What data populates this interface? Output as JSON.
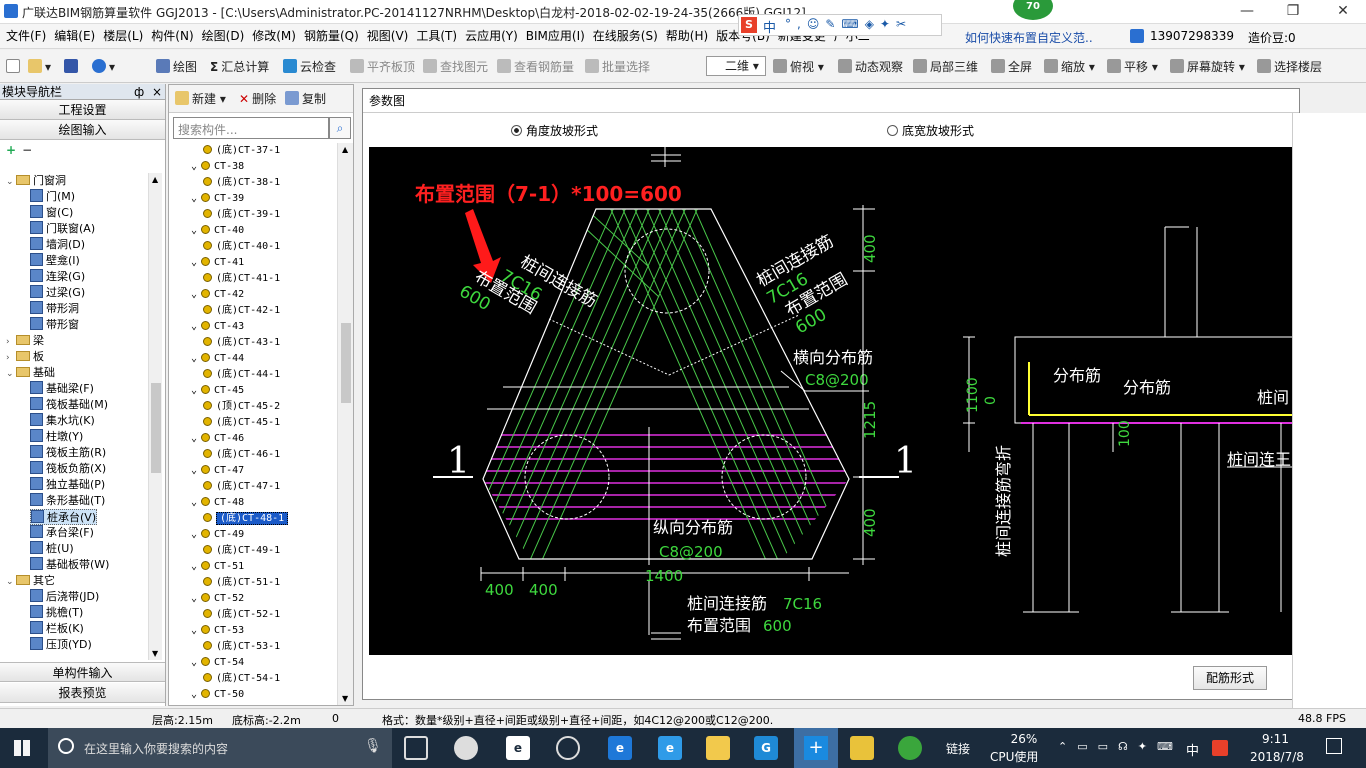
{
  "window": {
    "title": "广联达BIM钢筋算量软件 GGJ2013 - [C:\\Users\\Administrator.PC-20141127NRHM\\Desktop\\白龙村-2018-02-02-19-24-35(2666版).GGJ12]",
    "badge": "70",
    "ime": "中"
  },
  "menu": [
    "文件(F)",
    "编辑(E)",
    "楼层(L)",
    "构件(N)",
    "绘图(D)",
    "修改(M)",
    "钢筋量(Q)",
    "视图(V)",
    "工具(T)",
    "云应用(Y)",
    "BIM应用(I)",
    "在线服务(S)",
    "帮助(H)",
    "版本号(B)",
    "新建变更",
    "广小二"
  ],
  "menu_right": {
    "help_link": "如何快速布置自定义范..",
    "phone": "13907298339",
    "price": "造价豆:0"
  },
  "toolbar": {
    "draw": "绘图",
    "sum": "汇总计算",
    "cloud_check": "云检查",
    "flat_top": "平齐板顶",
    "find": "查找图元",
    "view_rebar": "查看钢筋量",
    "batch": "批量选择",
    "view_mode": "二维",
    "top_view": "俯视",
    "dynamic": "动态观察",
    "local3d": "局部三维",
    "fullscreen": "全屏",
    "zoom": "缩放",
    "pan": "平移",
    "rotate": "屏幕旋转",
    "select_floor": "选择楼层"
  },
  "nav": {
    "title": "模块导航栏",
    "pin": "ф",
    "close": "×",
    "proj": "工程设置",
    "draw_input": "绘图输入",
    "single": "单构件输入",
    "report": "报表预览",
    "tree": [
      {
        "level": 0,
        "label": "门窗洞",
        "type": "folder",
        "exp": "⌄"
      },
      {
        "level": 1,
        "label": "门(M)",
        "type": "leaf"
      },
      {
        "level": 1,
        "label": "窗(C)",
        "type": "leaf"
      },
      {
        "level": 1,
        "label": "门联窗(A)",
        "type": "leaf"
      },
      {
        "level": 1,
        "label": "墙洞(D)",
        "type": "leaf"
      },
      {
        "level": 1,
        "label": "壁龛(I)",
        "type": "leaf"
      },
      {
        "level": 1,
        "label": "连梁(G)",
        "type": "leaf"
      },
      {
        "level": 1,
        "label": "过梁(G)",
        "type": "leaf"
      },
      {
        "level": 1,
        "label": "带形洞",
        "type": "leaf"
      },
      {
        "level": 1,
        "label": "带形窗",
        "type": "leaf"
      },
      {
        "level": 0,
        "label": "梁",
        "type": "folder",
        "exp": "›"
      },
      {
        "level": 0,
        "label": "板",
        "type": "folder",
        "exp": "›"
      },
      {
        "level": 0,
        "label": "基础",
        "type": "folder",
        "exp": "⌄"
      },
      {
        "level": 1,
        "label": "基础梁(F)",
        "type": "leaf"
      },
      {
        "level": 1,
        "label": "筏板基础(M)",
        "type": "leaf"
      },
      {
        "level": 1,
        "label": "集水坑(K)",
        "type": "leaf"
      },
      {
        "level": 1,
        "label": "柱墩(Y)",
        "type": "leaf"
      },
      {
        "level": 1,
        "label": "筏板主筋(R)",
        "type": "leaf"
      },
      {
        "level": 1,
        "label": "筏板负筋(X)",
        "type": "leaf"
      },
      {
        "level": 1,
        "label": "独立基础(P)",
        "type": "leaf"
      },
      {
        "level": 1,
        "label": "条形基础(T)",
        "type": "leaf"
      },
      {
        "level": 1,
        "label": "桩承台(V)",
        "type": "leaf",
        "selected": true
      },
      {
        "level": 1,
        "label": "承台梁(F)",
        "type": "leaf"
      },
      {
        "level": 1,
        "label": "桩(U)",
        "type": "leaf"
      },
      {
        "level": 1,
        "label": "基础板带(W)",
        "type": "leaf"
      },
      {
        "level": 0,
        "label": "其它",
        "type": "folder",
        "exp": "⌄"
      },
      {
        "level": 1,
        "label": "后浇带(JD)",
        "type": "leaf"
      },
      {
        "level": 1,
        "label": "挑檐(T)",
        "type": "leaf"
      },
      {
        "level": 1,
        "label": "栏板(K)",
        "type": "leaf"
      },
      {
        "level": 1,
        "label": "压顶(YD)",
        "type": "leaf"
      }
    ]
  },
  "components": {
    "new": "新建",
    "delete": "删除",
    "copy": "复制",
    "search_placeholder": "搜索构件...",
    "items": [
      {
        "level": 1,
        "label": "(底)CT-37-1"
      },
      {
        "level": 0,
        "label": "CT-38"
      },
      {
        "level": 1,
        "label": "(底)CT-38-1"
      },
      {
        "level": 0,
        "label": "CT-39"
      },
      {
        "level": 1,
        "label": "(底)CT-39-1"
      },
      {
        "level": 0,
        "label": "CT-40"
      },
      {
        "level": 1,
        "label": "(底)CT-40-1"
      },
      {
        "level": 0,
        "label": "CT-41"
      },
      {
        "level": 1,
        "label": "(底)CT-41-1"
      },
      {
        "level": 0,
        "label": "CT-42"
      },
      {
        "level": 1,
        "label": "(底)CT-42-1"
      },
      {
        "level": 0,
        "label": "CT-43"
      },
      {
        "level": 1,
        "label": "(底)CT-43-1"
      },
      {
        "level": 0,
        "label": "CT-44"
      },
      {
        "level": 1,
        "label": "(底)CT-44-1"
      },
      {
        "level": 0,
        "label": "CT-45"
      },
      {
        "level": 1,
        "label": "(顶)CT-45-2"
      },
      {
        "level": 1,
        "label": "(底)CT-45-1"
      },
      {
        "level": 0,
        "label": "CT-46"
      },
      {
        "level": 1,
        "label": "(底)CT-46-1"
      },
      {
        "level": 0,
        "label": "CT-47"
      },
      {
        "level": 1,
        "label": "(底)CT-47-1"
      },
      {
        "level": 0,
        "label": "CT-48"
      },
      {
        "level": 1,
        "label": "(底)CT-48-1",
        "selected": true
      },
      {
        "level": 0,
        "label": "CT-49"
      },
      {
        "level": 1,
        "label": "(底)CT-49-1"
      },
      {
        "level": 0,
        "label": "CT-51"
      },
      {
        "level": 1,
        "label": "(底)CT-51-1"
      },
      {
        "level": 0,
        "label": "CT-52"
      },
      {
        "level": 1,
        "label": "(底)CT-52-1"
      },
      {
        "level": 0,
        "label": "CT-53"
      },
      {
        "level": 1,
        "label": "(底)CT-53-1"
      },
      {
        "level": 0,
        "label": "CT-54"
      },
      {
        "level": 1,
        "label": "(底)CT-54-1"
      },
      {
        "level": 0,
        "label": "CT-50"
      }
    ]
  },
  "dialog": {
    "title": "参数图",
    "radio1": "角度放坡形式",
    "radio2": "底宽放坡形式",
    "config_btn": "配筋形式"
  },
  "drawing": {
    "red_note": "布置范围（7-1）*100=600",
    "left_label1": "桩间连接筋",
    "left_val1": "7C16",
    "left_label2": "布置范围",
    "left_val2": "600",
    "right_label1": "桩间连接筋",
    "right_val1": "7C16",
    "right_label2": "布置范围",
    "right_val2": "600",
    "horiz_label": "横向分布筋",
    "horiz_val": "C8@200",
    "vert_label": "纵向分布筋",
    "vert_val": "C8@200",
    "bottom_label1": "桩间连接筋",
    "bottom_val1": "7C16",
    "bottom_label2": "布置范围",
    "bottom_val2": "600",
    "section": "1",
    "dim_400a": "400",
    "dim_400b": "400",
    "dim_1400": "1400",
    "dim_v400": "400",
    "dim_v1215": "1215",
    "dim_v400b": "400",
    "sec_dist1": "分布筋",
    "sec_dist2": "分布筋",
    "sec_pile": "桩间",
    "sec_pile2": "桩间连王",
    "sec_vert": "桩间连接筋弯折",
    "sec_1100": "1100",
    "sec_0": "0",
    "sec_100": "100"
  },
  "status": {
    "floor_h": "层高:2.15m",
    "bottom_h": "底标高:-2.2m",
    "zero": "0",
    "format": "格式：数量*级别+直径+间距或级别+直径+间距，如4C12@200或C12@200.",
    "fps": "48.8 FPS"
  },
  "taskbar": {
    "search": "在这里输入你要搜索的内容",
    "link": "链接",
    "cpu": "26%",
    "cpu_label": "CPU使用",
    "ime": "中",
    "time": "9:11",
    "date": "2018/7/8"
  }
}
